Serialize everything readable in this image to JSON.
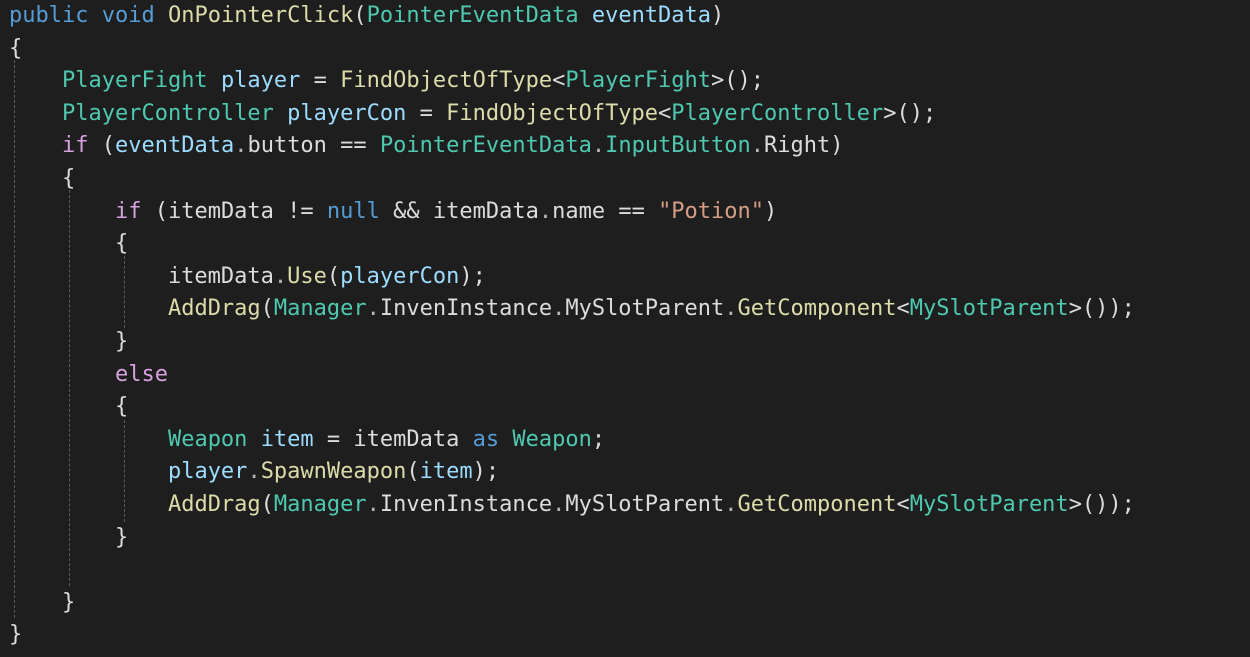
{
  "code": {
    "lines": [
      [
        [
          "kw",
          "public"
        ],
        [
          "pn",
          " "
        ],
        [
          "kw",
          "void"
        ],
        [
          "pn",
          " "
        ],
        [
          "fn",
          "OnPointerClick"
        ],
        [
          "pn",
          "("
        ],
        [
          "type",
          "PointerEventData"
        ],
        [
          "pn",
          " "
        ],
        [
          "var",
          "eventData"
        ],
        [
          "pn",
          ")"
        ]
      ],
      [
        [
          "pn",
          "{"
        ]
      ],
      [
        [
          "pn",
          "    "
        ],
        [
          "type",
          "PlayerFight"
        ],
        [
          "pn",
          " "
        ],
        [
          "var",
          "player"
        ],
        [
          "pn",
          " = "
        ],
        [
          "fn",
          "FindObjectOfType"
        ],
        [
          "pn",
          "<"
        ],
        [
          "type",
          "PlayerFight"
        ],
        [
          "pn",
          ">();"
        ]
      ],
      [
        [
          "pn",
          "    "
        ],
        [
          "type",
          "PlayerController"
        ],
        [
          "pn",
          " "
        ],
        [
          "var",
          "playerCon"
        ],
        [
          "pn",
          " = "
        ],
        [
          "fn",
          "FindObjectOfType"
        ],
        [
          "pn",
          "<"
        ],
        [
          "type",
          "PlayerController"
        ],
        [
          "pn",
          ">();"
        ]
      ],
      [
        [
          "pn",
          "    "
        ],
        [
          "ctl",
          "if"
        ],
        [
          "pn",
          " ("
        ],
        [
          "var",
          "eventData"
        ],
        [
          "gr",
          "."
        ],
        [
          "pn",
          "button == "
        ],
        [
          "type",
          "PointerEventData"
        ],
        [
          "gr",
          "."
        ],
        [
          "type",
          "InputButton"
        ],
        [
          "gr",
          "."
        ],
        [
          "pn",
          "Right)"
        ]
      ],
      [
        [
          "pn",
          "    {"
        ]
      ],
      [
        [
          "pn",
          "        "
        ],
        [
          "ctl",
          "if"
        ],
        [
          "pn",
          " (itemData != "
        ],
        [
          "kw",
          "null"
        ],
        [
          "pn",
          " && itemData"
        ],
        [
          "gr",
          "."
        ],
        [
          "pn",
          "name == "
        ],
        [
          "str",
          "\"Potion\""
        ],
        [
          "pn",
          ")"
        ]
      ],
      [
        [
          "pn",
          "        {"
        ]
      ],
      [
        [
          "pn",
          "            itemData"
        ],
        [
          "gr",
          "."
        ],
        [
          "fn",
          "Use"
        ],
        [
          "pn",
          "("
        ],
        [
          "var",
          "playerCon"
        ],
        [
          "pn",
          ");"
        ]
      ],
      [
        [
          "pn",
          "            "
        ],
        [
          "fn",
          "AddDrag"
        ],
        [
          "pn",
          "("
        ],
        [
          "type",
          "Manager"
        ],
        [
          "gr",
          "."
        ],
        [
          "pn",
          "InvenInstance"
        ],
        [
          "gr",
          "."
        ],
        [
          "pn",
          "MySlotParent"
        ],
        [
          "gr",
          "."
        ],
        [
          "fn",
          "GetComponent"
        ],
        [
          "pn",
          "<"
        ],
        [
          "type",
          "MySlotParent"
        ],
        [
          "pn",
          ">());"
        ]
      ],
      [
        [
          "pn",
          "        }"
        ]
      ],
      [
        [
          "pn",
          "        "
        ],
        [
          "ctl",
          "else"
        ]
      ],
      [
        [
          "pn",
          "        {"
        ]
      ],
      [
        [
          "pn",
          "            "
        ],
        [
          "type",
          "Weapon"
        ],
        [
          "pn",
          " "
        ],
        [
          "var",
          "item"
        ],
        [
          "pn",
          " = itemData "
        ],
        [
          "kw",
          "as"
        ],
        [
          "pn",
          " "
        ],
        [
          "type",
          "Weapon"
        ],
        [
          "pn",
          ";"
        ]
      ],
      [
        [
          "pn",
          "            "
        ],
        [
          "var",
          "player"
        ],
        [
          "gr",
          "."
        ],
        [
          "fn",
          "SpawnWeapon"
        ],
        [
          "pn",
          "("
        ],
        [
          "var",
          "item"
        ],
        [
          "pn",
          ");"
        ]
      ],
      [
        [
          "pn",
          "            "
        ],
        [
          "fn",
          "AddDrag"
        ],
        [
          "pn",
          "("
        ],
        [
          "type",
          "Manager"
        ],
        [
          "gr",
          "."
        ],
        [
          "pn",
          "InvenInstance"
        ],
        [
          "gr",
          "."
        ],
        [
          "pn",
          "MySlotParent"
        ],
        [
          "gr",
          "."
        ],
        [
          "fn",
          "GetComponent"
        ],
        [
          "pn",
          "<"
        ],
        [
          "type",
          "MySlotParent"
        ],
        [
          "pn",
          ">());"
        ]
      ],
      [
        [
          "pn",
          "        }"
        ]
      ],
      [
        [
          "pn",
          ""
        ]
      ],
      [
        [
          "pn",
          "    }"
        ]
      ],
      [
        [
          "pn",
          "}"
        ]
      ]
    ]
  }
}
